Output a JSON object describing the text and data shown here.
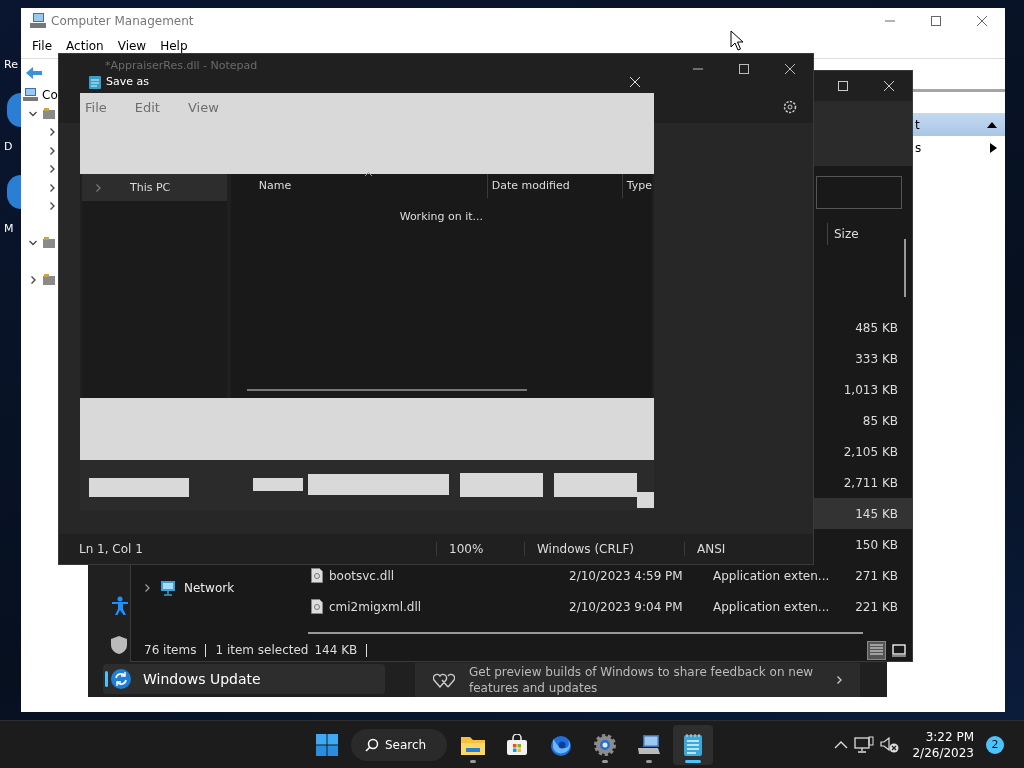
{
  "desktop": {
    "icons": [
      {
        "kind": "label",
        "label": "Re"
      },
      {
        "kind": "icon",
        "label": "D"
      },
      {
        "kind": "icon",
        "label": "M"
      }
    ]
  },
  "computer_management": {
    "title": "Computer Management",
    "menu": [
      "File",
      "Action",
      "View",
      "Help"
    ],
    "tree": [
      {
        "kind": "root",
        "label": "Co",
        "children": [
          {
            "kind": "folder",
            "expanded": true,
            "children": [
              {
                "kind": "folder",
                "expanded": false
              },
              {
                "kind": "folder",
                "expanded": false
              },
              {
                "kind": "folder",
                "expanded": false
              },
              {
                "kind": "folder",
                "expanded": false
              },
              {
                "kind": "folder",
                "expanded": false
              },
              {
                "kind": "leaf"
              }
            ]
          },
          {
            "kind": "folder",
            "expanded": true,
            "children": [
              {
                "kind": "leaf"
              }
            ]
          },
          {
            "kind": "folder",
            "expanded": false
          }
        ]
      }
    ],
    "actions": [
      {
        "kind": "header",
        "label": "t",
        "selected": true
      },
      {
        "kind": "submenu",
        "label": "s",
        "selected": false
      }
    ]
  },
  "settings": {
    "nav": [
      {
        "kind": "accessibility",
        "selected": false
      },
      {
        "kind": "privacy",
        "selected": false
      },
      {
        "kind": "update",
        "label": "Windows Update",
        "selected": true
      }
    ],
    "promo": {
      "text": "Get preview builds of Windows to share feedback on new features and updates"
    }
  },
  "file_explorer": {
    "size_header": "Size",
    "nav": [
      {
        "label": "Network",
        "expanded": false
      }
    ],
    "rows": [
      {
        "size": "485 KB",
        "selected": false
      },
      {
        "size": "333 KB",
        "selected": false
      },
      {
        "size": "1,013 KB",
        "selected": false
      },
      {
        "size": "85 KB",
        "selected": false
      },
      {
        "size": "2,105 KB",
        "selected": false
      },
      {
        "size": "2,711 KB",
        "selected": false
      },
      {
        "size": "145 KB",
        "selected": true
      },
      {
        "size": "150 KB",
        "selected": false
      },
      {
        "name": "bootsvc.dll",
        "date": "2/10/2023 4:59 PM",
        "type": "Application exten...",
        "size": "271 KB",
        "selected": false
      },
      {
        "name": "cmi2migxml.dll",
        "date": "2/10/2023 9:04 PM",
        "type": "Application exten...",
        "size": "221 KB",
        "selected": false
      }
    ],
    "status_bar": {
      "item_count": "76 items",
      "selection": "1 item selected",
      "selection_size": "144 KB"
    },
    "view_modes": [
      {
        "kind": "details",
        "selected": true
      },
      {
        "kind": "tiles",
        "selected": false
      }
    ]
  },
  "notepad": {
    "title": "*AppraiserRes.dll - Notepad",
    "menu": [
      "File",
      "Edit",
      "View"
    ],
    "status_bar": [
      "Ln 1, Col 1",
      "100%",
      "Windows (CRLF)",
      "ANSI"
    ]
  },
  "save_as_dialog": {
    "title": "Save as",
    "nav": [
      {
        "label": "This PC",
        "expanded": false,
        "selected": true
      }
    ],
    "columns": [
      "Name",
      "Date modified",
      "Type"
    ],
    "message": "Working on it..."
  },
  "taskbar": {
    "search": "Search",
    "apps": [
      {
        "kind": "file-explorer",
        "running": true,
        "active": false
      },
      {
        "kind": "store",
        "running": false,
        "active": false
      },
      {
        "kind": "browser",
        "running": false,
        "active": false
      },
      {
        "kind": "settings",
        "running": true,
        "active": false
      },
      {
        "kind": "computer-management",
        "running": true,
        "active": false
      },
      {
        "kind": "notepad",
        "running": true,
        "active": true
      }
    ],
    "clock": {
      "time": "3:22 PM",
      "date": "2/26/2023"
    },
    "notification_count": "2"
  }
}
